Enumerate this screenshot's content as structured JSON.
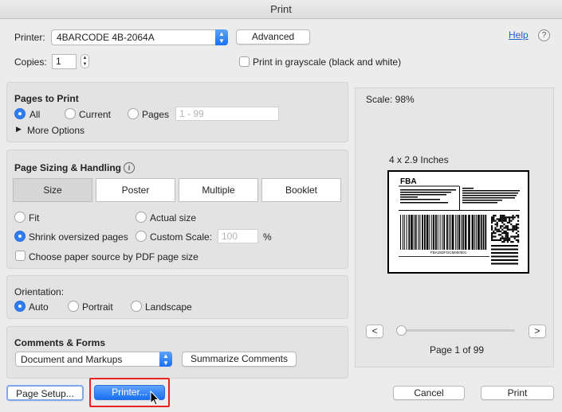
{
  "window": {
    "title": "Print"
  },
  "top": {
    "printer_label": "Printer:",
    "printer_value": "4BARCODE 4B-2064A",
    "advanced_label": "Advanced",
    "help_label": "Help",
    "help_icon": "?",
    "copies_label": "Copies:",
    "copies_value": "1",
    "grayscale_label": "Print in grayscale (black and white)"
  },
  "pages_to_print": {
    "title": "Pages to Print",
    "all": "All",
    "current": "Current",
    "pages": "Pages",
    "pages_placeholder": "1 - 99",
    "more_options": "More Options",
    "selected": "All"
  },
  "page_sizing": {
    "title": "Page Sizing & Handling",
    "info_icon": "i",
    "tabs": [
      "Size",
      "Poster",
      "Multiple",
      "Booklet"
    ],
    "active_tab": "Size",
    "fit": "Fit",
    "actual_size": "Actual size",
    "shrink": "Shrink oversized pages",
    "custom_scale": "Custom Scale:",
    "custom_scale_value": "100",
    "percent": "%",
    "paper_source": "Choose paper source by PDF page size",
    "selected": "Shrink oversized pages"
  },
  "orientation": {
    "title": "Orientation:",
    "auto": "Auto",
    "portrait": "Portrait",
    "landscape": "Landscape",
    "selected": "Auto"
  },
  "comments_forms": {
    "title": "Comments & Forms",
    "select_value": "Document and Markups",
    "summarize": "Summarize Comments"
  },
  "preview": {
    "scale": "Scale:  98%",
    "size": "4 x 2.9 Inches",
    "label_heading": "FBA",
    "barcode_text": "FBA15DFGCM000001",
    "prev": "<",
    "next": ">",
    "page_indicator": "Page 1 of 99",
    "slider_position": 0
  },
  "footer": {
    "page_setup": "Page Setup...",
    "printer": "Printer...",
    "cancel": "Cancel",
    "print": "Print"
  }
}
